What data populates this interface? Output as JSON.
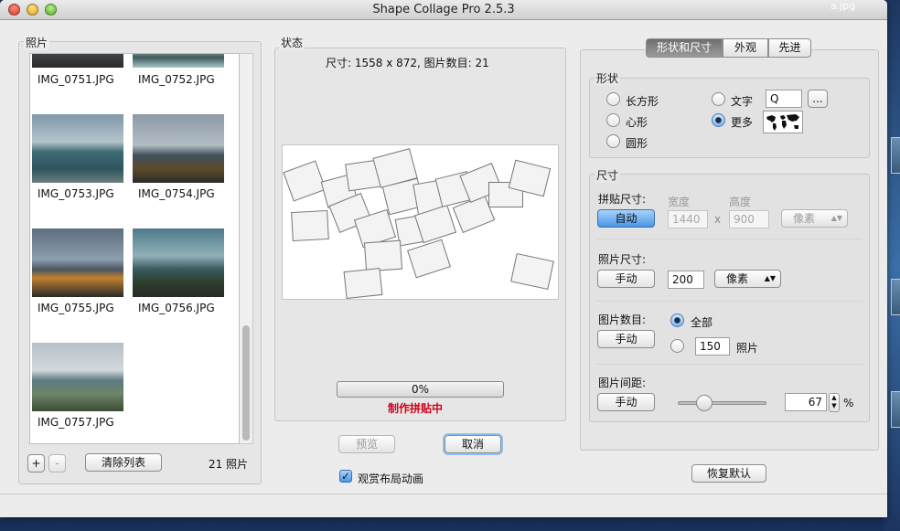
{
  "window": {
    "title": "Shape Collage Pro 2.5.3",
    "background_window_title": "a.jpg"
  },
  "photos_panel": {
    "label": "照片",
    "items": [
      {
        "name": "IMG_0751.JPG"
      },
      {
        "name": "IMG_0752.JPG"
      },
      {
        "name": "IMG_0753.JPG"
      },
      {
        "name": "IMG_0754.JPG"
      },
      {
        "name": "IMG_0755.JPG"
      },
      {
        "name": "IMG_0756.JPG"
      },
      {
        "name": "IMG_0757.JPG"
      }
    ],
    "add_label": "+",
    "remove_label": "-",
    "clear_label": "清除列表",
    "count_label": "21 照片"
  },
  "status_panel": {
    "label": "状态",
    "info": "尺寸:  1558 x 872, 图片数目:  21",
    "progress_text": "0%",
    "progress_fraction": 0,
    "status_message": "制作拼贴中",
    "status_color": "#d0021b"
  },
  "actions": {
    "preview_label": "预览",
    "cancel_label": "取消",
    "watch_anim_label": "观赏布局动画",
    "watch_anim_checked": true
  },
  "tabs": [
    {
      "label": "形状和尺寸",
      "selected": true
    },
    {
      "label": "外观",
      "selected": false
    },
    {
      "label": "先进",
      "selected": false
    }
  ],
  "shape": {
    "label": "形状",
    "options": {
      "rectangle": "长方形",
      "heart": "心形",
      "circle": "圆形",
      "text": "文字",
      "more": "更多"
    },
    "selected": "more",
    "text_value": "Q",
    "ellipsis_label": "..."
  },
  "size": {
    "label": "尺寸",
    "collage_size_label": "拼贴尺寸:",
    "collage_mode_label": "自动",
    "width_label": "宽度",
    "height_label": "高度",
    "width_value": "1440",
    "height_value": "900",
    "times": "x",
    "unit_label": "像素",
    "photo_size_label": "照片尺寸:",
    "photo_mode_label": "手动",
    "photo_size_value": "200",
    "photo_unit_label": "像素",
    "photo_count_label": "图片数目:",
    "count_all_label": "全部",
    "count_mode_label": "手动",
    "count_value": "150",
    "count_unit": "照片",
    "count_selected": "all",
    "spacing_label": "图片间距:",
    "spacing_mode_label": "手动",
    "spacing_value": "67",
    "spacing_unit": "%",
    "spacing_slider_fraction": 0.25
  },
  "restore_defaults_label": "恢复默认",
  "colors": {
    "accent_blue": "#4b95e6",
    "window_bg": "#ececec"
  }
}
